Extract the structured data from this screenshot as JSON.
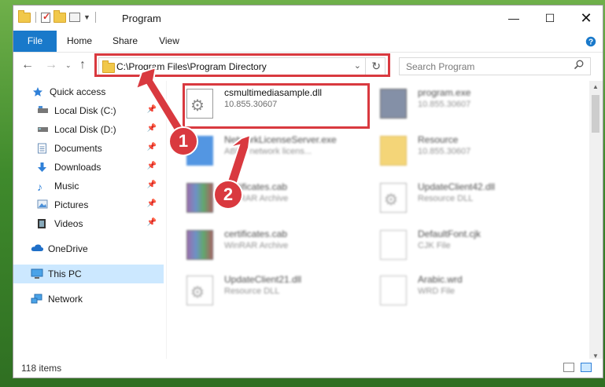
{
  "window": {
    "title": "Program"
  },
  "ribbon": {
    "tabs": [
      "File",
      "Home",
      "Share",
      "View"
    ],
    "help": "?"
  },
  "address": {
    "path": "C:\\Program Files\\Program Directory"
  },
  "search": {
    "placeholder": "Search Program"
  },
  "sidebar": {
    "items": [
      {
        "label": "Quick access"
      },
      {
        "label": "Local Disk (C:)"
      },
      {
        "label": "Local Disk (D:)"
      },
      {
        "label": "Documents"
      },
      {
        "label": "Downloads"
      },
      {
        "label": "Music"
      },
      {
        "label": "Pictures"
      },
      {
        "label": "Videos"
      },
      {
        "label": "OneDrive"
      },
      {
        "label": "This PC"
      },
      {
        "label": "Network"
      }
    ]
  },
  "files": [
    {
      "name": "csmultimediasample.dll",
      "sub": "10.855.30607"
    },
    {
      "name": "program.exe",
      "sub": "10.855.30607"
    },
    {
      "name": "NetworkLicenseServer.exe",
      "sub": "ABBY network licens..."
    },
    {
      "name": "Resource",
      "sub": "10.855.30607"
    },
    {
      "name": "certificates.cab",
      "sub": "WinRAR Archive"
    },
    {
      "name": "UpdateClient42.dll",
      "sub": "Resource DLL"
    },
    {
      "name": "certificates.cab",
      "sub": "WinRAR Archive"
    },
    {
      "name": "DefaultFont.cjk",
      "sub": "CJK File"
    },
    {
      "name": "UpdateClient21.dll",
      "sub": "Resource DLL"
    },
    {
      "name": "Arabic.wrd",
      "sub": "WRD File"
    }
  ],
  "annotations": {
    "badge1": "1",
    "badge2": "2",
    "accent": "#d9393f"
  },
  "status": {
    "items": "118 items"
  },
  "colors": {
    "file_tab": "#1979ca",
    "selected": "#cce8ff"
  }
}
